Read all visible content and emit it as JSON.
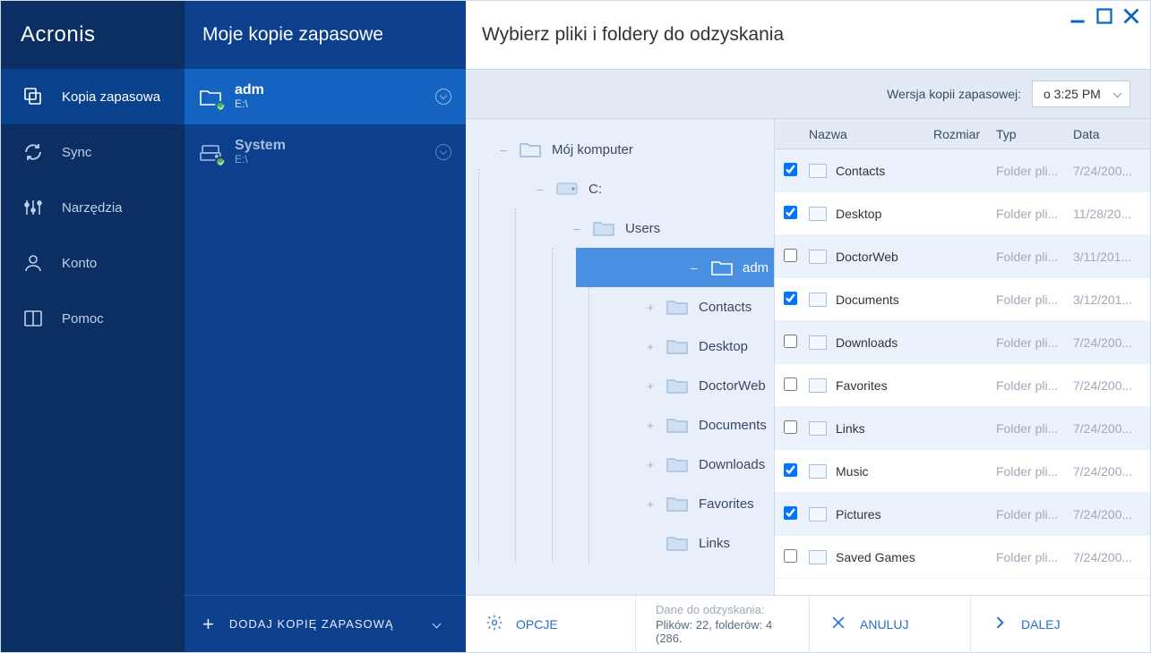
{
  "brand": "Acronis",
  "nav": [
    {
      "label": "Kopia zapasowa",
      "active": true,
      "icon": "backup"
    },
    {
      "label": "Sync",
      "active": false,
      "icon": "sync"
    },
    {
      "label": "Narzędzia",
      "active": false,
      "icon": "tools"
    },
    {
      "label": "Konto",
      "active": false,
      "icon": "account"
    },
    {
      "label": "Pomoc",
      "active": false,
      "icon": "help"
    }
  ],
  "backups_header": "Moje kopie zapasowe",
  "backups": [
    {
      "name": "adm",
      "path": "E:\\",
      "selected": true,
      "status": "ok",
      "icon": "folder"
    },
    {
      "name": "System",
      "path": "E:\\",
      "selected": false,
      "status": "ok",
      "icon": "drive"
    }
  ],
  "add_backup_label": "DODAJ KOPIĘ ZAPASOWĄ",
  "main_title": "Wybierz pliki i foldery do odzyskania",
  "version_label": "Wersja kopii zapasowej:",
  "version_value": "o 3:25 PM",
  "tree": {
    "root": {
      "label": "Mój komputer",
      "expander": "–"
    },
    "drive": {
      "label": "C:",
      "expander": "–"
    },
    "users": {
      "label": "Users",
      "expander": "–"
    },
    "adm": {
      "label": "adm",
      "expander": "–",
      "selected": true
    },
    "children": [
      {
        "label": "Contacts",
        "expander": "+"
      },
      {
        "label": "Desktop",
        "expander": "+"
      },
      {
        "label": "DoctorWeb",
        "expander": "+"
      },
      {
        "label": "Documents",
        "expander": "+"
      },
      {
        "label": "Downloads",
        "expander": "+"
      },
      {
        "label": "Favorites",
        "expander": "+"
      },
      {
        "label": "Links",
        "expander": ""
      }
    ]
  },
  "columns": {
    "name": "Nazwa",
    "size": "Rozmiar",
    "type": "Typ",
    "date": "Data"
  },
  "rows": [
    {
      "checked": true,
      "name": "Contacts",
      "size": "",
      "type": "Folder pli...",
      "date": "7/24/200..."
    },
    {
      "checked": true,
      "name": "Desktop",
      "size": "",
      "type": "Folder pli...",
      "date": "11/28/20..."
    },
    {
      "checked": false,
      "name": "DoctorWeb",
      "size": "",
      "type": "Folder pli...",
      "date": "3/11/201..."
    },
    {
      "checked": true,
      "name": "Documents",
      "size": "",
      "type": "Folder pli...",
      "date": "3/12/201..."
    },
    {
      "checked": false,
      "name": "Downloads",
      "size": "",
      "type": "Folder pli...",
      "date": "7/24/200..."
    },
    {
      "checked": false,
      "name": "Favorites",
      "size": "",
      "type": "Folder pli...",
      "date": "7/24/200..."
    },
    {
      "checked": false,
      "name": "Links",
      "size": "",
      "type": "Folder pli...",
      "date": "7/24/200..."
    },
    {
      "checked": true,
      "name": "Music",
      "size": "",
      "type": "Folder pli...",
      "date": "7/24/200..."
    },
    {
      "checked": true,
      "name": "Pictures",
      "size": "",
      "type": "Folder pli...",
      "date": "7/24/200..."
    },
    {
      "checked": false,
      "name": "Saved Games",
      "size": "",
      "type": "Folder pli...",
      "date": "7/24/200..."
    }
  ],
  "bottom": {
    "options": "OPCJE",
    "info_line1": "Dane do odzyskania:",
    "info_line2": "Plików: 22, folderów: 4 (286.",
    "cancel": "ANULUJ",
    "next": "DALEJ"
  }
}
